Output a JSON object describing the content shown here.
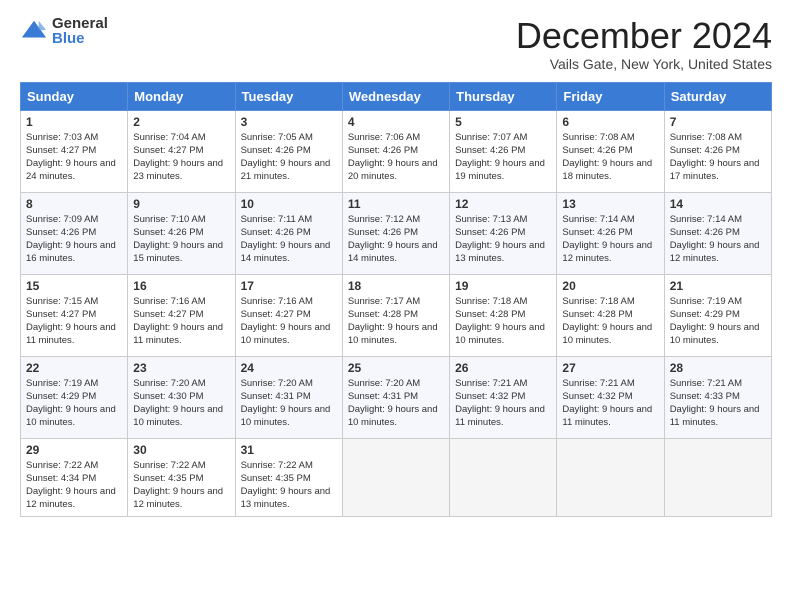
{
  "logo": {
    "general": "General",
    "blue": "Blue"
  },
  "title": "December 2024",
  "subtitle": "Vails Gate, New York, United States",
  "headers": [
    "Sunday",
    "Monday",
    "Tuesday",
    "Wednesday",
    "Thursday",
    "Friday",
    "Saturday"
  ],
  "weeks": [
    [
      {
        "day": "1",
        "sunrise": "7:03 AM",
        "sunset": "4:27 PM",
        "daylight": "9 hours and 24 minutes."
      },
      {
        "day": "2",
        "sunrise": "7:04 AM",
        "sunset": "4:27 PM",
        "daylight": "9 hours and 23 minutes."
      },
      {
        "day": "3",
        "sunrise": "7:05 AM",
        "sunset": "4:26 PM",
        "daylight": "9 hours and 21 minutes."
      },
      {
        "day": "4",
        "sunrise": "7:06 AM",
        "sunset": "4:26 PM",
        "daylight": "9 hours and 20 minutes."
      },
      {
        "day": "5",
        "sunrise": "7:07 AM",
        "sunset": "4:26 PM",
        "daylight": "9 hours and 19 minutes."
      },
      {
        "day": "6",
        "sunrise": "7:08 AM",
        "sunset": "4:26 PM",
        "daylight": "9 hours and 18 minutes."
      },
      {
        "day": "7",
        "sunrise": "7:08 AM",
        "sunset": "4:26 PM",
        "daylight": "9 hours and 17 minutes."
      }
    ],
    [
      {
        "day": "8",
        "sunrise": "7:09 AM",
        "sunset": "4:26 PM",
        "daylight": "9 hours and 16 minutes."
      },
      {
        "day": "9",
        "sunrise": "7:10 AM",
        "sunset": "4:26 PM",
        "daylight": "9 hours and 15 minutes."
      },
      {
        "day": "10",
        "sunrise": "7:11 AM",
        "sunset": "4:26 PM",
        "daylight": "9 hours and 14 minutes."
      },
      {
        "day": "11",
        "sunrise": "7:12 AM",
        "sunset": "4:26 PM",
        "daylight": "9 hours and 14 minutes."
      },
      {
        "day": "12",
        "sunrise": "7:13 AM",
        "sunset": "4:26 PM",
        "daylight": "9 hours and 13 minutes."
      },
      {
        "day": "13",
        "sunrise": "7:14 AM",
        "sunset": "4:26 PM",
        "daylight": "9 hours and 12 minutes."
      },
      {
        "day": "14",
        "sunrise": "7:14 AM",
        "sunset": "4:26 PM",
        "daylight": "9 hours and 12 minutes."
      }
    ],
    [
      {
        "day": "15",
        "sunrise": "7:15 AM",
        "sunset": "4:27 PM",
        "daylight": "9 hours and 11 minutes."
      },
      {
        "day": "16",
        "sunrise": "7:16 AM",
        "sunset": "4:27 PM",
        "daylight": "9 hours and 11 minutes."
      },
      {
        "day": "17",
        "sunrise": "7:16 AM",
        "sunset": "4:27 PM",
        "daylight": "9 hours and 10 minutes."
      },
      {
        "day": "18",
        "sunrise": "7:17 AM",
        "sunset": "4:28 PM",
        "daylight": "9 hours and 10 minutes."
      },
      {
        "day": "19",
        "sunrise": "7:18 AM",
        "sunset": "4:28 PM",
        "daylight": "9 hours and 10 minutes."
      },
      {
        "day": "20",
        "sunrise": "7:18 AM",
        "sunset": "4:28 PM",
        "daylight": "9 hours and 10 minutes."
      },
      {
        "day": "21",
        "sunrise": "7:19 AM",
        "sunset": "4:29 PM",
        "daylight": "9 hours and 10 minutes."
      }
    ],
    [
      {
        "day": "22",
        "sunrise": "7:19 AM",
        "sunset": "4:29 PM",
        "daylight": "9 hours and 10 minutes."
      },
      {
        "day": "23",
        "sunrise": "7:20 AM",
        "sunset": "4:30 PM",
        "daylight": "9 hours and 10 minutes."
      },
      {
        "day": "24",
        "sunrise": "7:20 AM",
        "sunset": "4:31 PM",
        "daylight": "9 hours and 10 minutes."
      },
      {
        "day": "25",
        "sunrise": "7:20 AM",
        "sunset": "4:31 PM",
        "daylight": "9 hours and 10 minutes."
      },
      {
        "day": "26",
        "sunrise": "7:21 AM",
        "sunset": "4:32 PM",
        "daylight": "9 hours and 11 minutes."
      },
      {
        "day": "27",
        "sunrise": "7:21 AM",
        "sunset": "4:32 PM",
        "daylight": "9 hours and 11 minutes."
      },
      {
        "day": "28",
        "sunrise": "7:21 AM",
        "sunset": "4:33 PM",
        "daylight": "9 hours and 11 minutes."
      }
    ],
    [
      {
        "day": "29",
        "sunrise": "7:22 AM",
        "sunset": "4:34 PM",
        "daylight": "9 hours and 12 minutes."
      },
      {
        "day": "30",
        "sunrise": "7:22 AM",
        "sunset": "4:35 PM",
        "daylight": "9 hours and 12 minutes."
      },
      {
        "day": "31",
        "sunrise": "7:22 AM",
        "sunset": "4:35 PM",
        "daylight": "9 hours and 13 minutes."
      },
      null,
      null,
      null,
      null
    ]
  ],
  "labels": {
    "sunrise": "Sunrise:",
    "sunset": "Sunset:",
    "daylight": "Daylight:"
  }
}
